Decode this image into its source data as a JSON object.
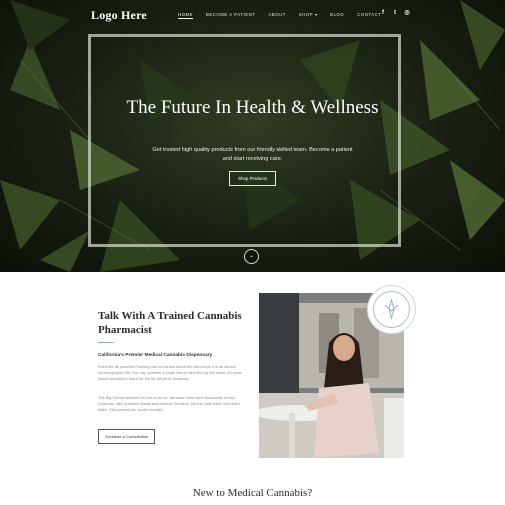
{
  "nav": {
    "logo": "Logo Here",
    "items": [
      "HOME",
      "BECOME A PATIENT",
      "ABOUT",
      "SHOP",
      "BLOG",
      "CONTACT"
    ],
    "social_icons": [
      "facebook-icon",
      "twitter-icon",
      "instagram-icon"
    ]
  },
  "hero": {
    "title": "The Future In Health & Wellness",
    "subtitle": "Get trusted high quality products from our friendly skilled team. Become a patient and start receiving care.",
    "button": "Shop Products",
    "scroll_icon": "chevron-down-icon"
  },
  "about": {
    "title": "Talk With A Trained Cannabis Pharmacist",
    "lead": "California's Premier Medical Cannabis Dispensary",
    "para1": "Even the all-powerful Pointing has no control about the blind texts it is an almost unorthographic life One day however a small line of blind text by the name of Lorem Ipsum decided to leave for the far World of Grammar.",
    "para2": "The Big Oxmox advised her not to do so, because there were thousands of bad Commas, wild Question Marks and devious Semikoli, but the Little Blind Text didn't listen. She packed her seven versalia.",
    "button": "Schedule a Consultation",
    "badge_icon": "cannabis-leaf-seal-icon"
  },
  "next_section": {
    "title": "New to Medical Cannabis?"
  },
  "colors": {
    "hero_dark": "#1e2716",
    "leaf": "#4f6a32",
    "accent": "#8ab89a",
    "badge_ring": "#a8bfc8"
  }
}
